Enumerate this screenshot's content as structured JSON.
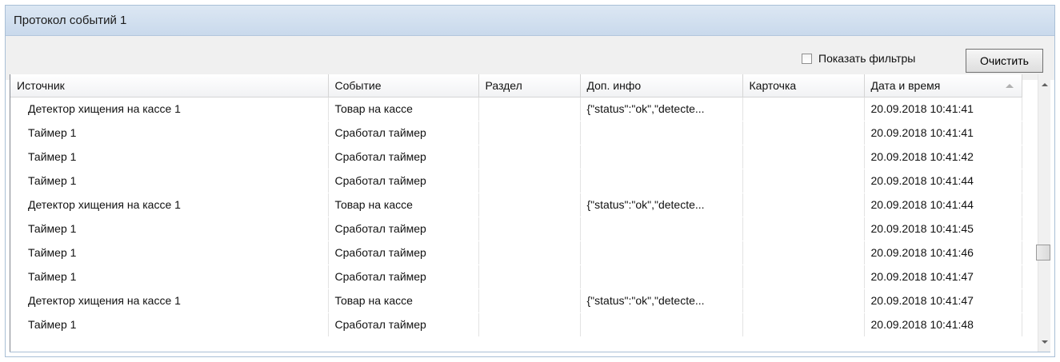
{
  "window": {
    "title": "Протокол событий 1"
  },
  "toolbar": {
    "show_filters_label": "Показать фильтры",
    "show_filters_checked": false,
    "clear_label": "Очистить"
  },
  "table": {
    "columns": [
      "Источник",
      "Событие",
      "Раздел",
      "Доп. инфо",
      "Карточка",
      "Дата и время"
    ],
    "sorted_column": "Дата и время",
    "rows": [
      [
        "Детектор хищения на кассе 1",
        "Товар на кассе",
        "",
        "{\"status\":\"ok\",\"detecte...",
        "",
        "20.09.2018 10:41:41"
      ],
      [
        "Таймер 1",
        "Сработал таймер",
        "",
        "",
        "",
        "20.09.2018 10:41:41"
      ],
      [
        "Таймер 1",
        "Сработал таймер",
        "",
        "",
        "",
        "20.09.2018 10:41:42"
      ],
      [
        "Таймер 1",
        "Сработал таймер",
        "",
        "",
        "",
        "20.09.2018 10:41:44"
      ],
      [
        "Детектор хищения на кассе 1",
        "Товар на кассе",
        "",
        "{\"status\":\"ok\",\"detecte...",
        "",
        "20.09.2018 10:41:44"
      ],
      [
        "Таймер 1",
        "Сработал таймер",
        "",
        "",
        "",
        "20.09.2018 10:41:45"
      ],
      [
        "Таймер 1",
        "Сработал таймер",
        "",
        "",
        "",
        "20.09.2018 10:41:46"
      ],
      [
        "Таймер 1",
        "Сработал таймер",
        "",
        "",
        "",
        "20.09.2018 10:41:47"
      ],
      [
        "Детектор хищения на кассе 1",
        "Товар на кассе",
        "",
        "{\"status\":\"ok\",\"detecte...",
        "",
        "20.09.2018 10:41:47"
      ],
      [
        "Таймер 1",
        "Сработал таймер",
        "",
        "",
        "",
        "20.09.2018 10:41:48"
      ]
    ]
  }
}
